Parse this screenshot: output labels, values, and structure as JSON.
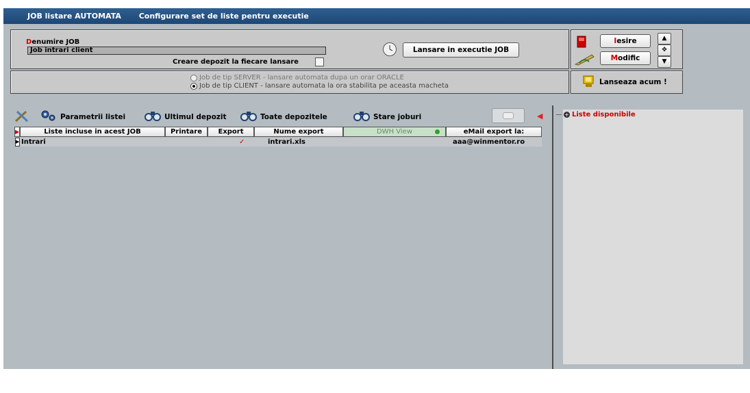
{
  "title_bar": {
    "module": "JOB listare AUTOMATA",
    "subtitle": "Configurare set de liste pentru executie"
  },
  "job": {
    "name_label_first": "D",
    "name_label_rest": "enumire JOB",
    "name_value": "Job intrari client",
    "deposit_label": "Creare depozit la fiecare lansare",
    "launch_button": "Lansare in executie JOB"
  },
  "job_type": {
    "server_option": "Job de tip SERVER  - lansare automata dupa un orar ORACLE",
    "client_option": "Job de tip CLIENT   - lansare automata la ora stabilita pe aceasta macheta",
    "selected": "client"
  },
  "actions": {
    "exit_first": "I",
    "exit_rest": "esire",
    "modify_first": "M",
    "modify_rest": "odific",
    "run_now": "Lanseaza acum !"
  },
  "toolbar": {
    "params": "Parametrii listei",
    "last_deposit": "Ultimul depozit",
    "all_deposits": "Toate depozitele",
    "job_status": "Stare joburi"
  },
  "table": {
    "columns": [
      "Liste incluse in acest JOB",
      "Printare",
      "Export",
      "Nume export",
      "DWH View",
      "eMail export la:"
    ],
    "rows": [
      {
        "list": "Intrari",
        "print": "",
        "export": "✓",
        "export_name": "intrari.xls",
        "dwh": "",
        "email": "aaa@winmentor.ro"
      }
    ]
  },
  "right_panel": {
    "tree_root": "Liste disponibile"
  },
  "colors": {
    "titlebar": "#1d4775",
    "accent_red": "#d00000",
    "background": "#b4bcc2"
  }
}
